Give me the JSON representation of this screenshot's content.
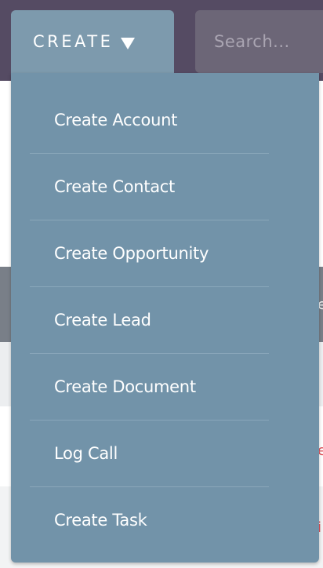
{
  "header": {
    "create_label": "CREATE",
    "search_placeholder": "Search..."
  },
  "create_menu": {
    "items": [
      {
        "label": "Create Account"
      },
      {
        "label": "Create Contact"
      },
      {
        "label": "Create Opportunity"
      },
      {
        "label": "Create Lead"
      },
      {
        "label": "Create Document"
      },
      {
        "label": "Log Call"
      },
      {
        "label": "Create Task"
      }
    ]
  },
  "background_text": {
    "glyph_1": "e",
    "glyph_2": "e",
    "glyph_3": "i"
  },
  "icons": {
    "create_caret": "caret-down-icon"
  },
  "colors": {
    "topbar": "#554b63",
    "create_button": "#7d9aad",
    "search_field": "#6c6677",
    "dropdown": "#7293a9",
    "divider": "#8aa7ba",
    "accent_red": "#e0525a"
  }
}
